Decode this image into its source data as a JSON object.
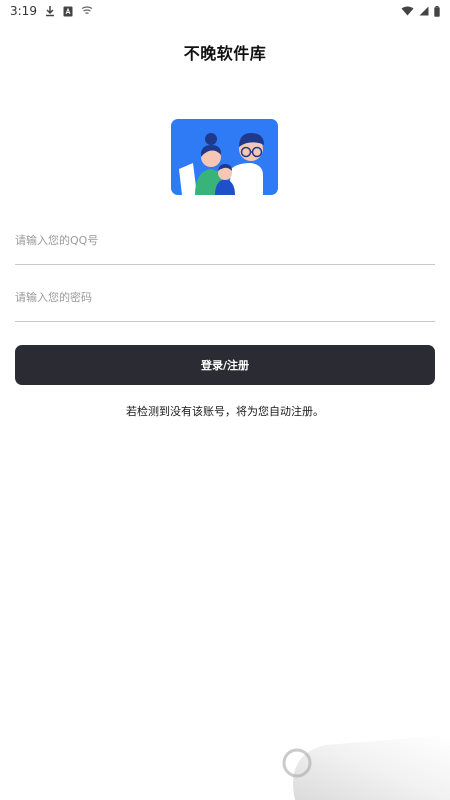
{
  "status_bar": {
    "time": "3:19",
    "icons_left": [
      "download-icon",
      "a-box-icon",
      "cast-icon"
    ],
    "icons_right": [
      "wifi-icon",
      "signal-icon",
      "battery-icon"
    ]
  },
  "app": {
    "title": "不晚软件库"
  },
  "illustration": {
    "icon": "family-illustration-icon",
    "bg_color": "#2f7bf5"
  },
  "form": {
    "qq_placeholder": "请输入您的QQ号",
    "qq_value": "",
    "password_placeholder": "请输入您的密码",
    "password_value": "",
    "submit_label": "登录/注册"
  },
  "hint_text": "若检测到没有该账号，将为您自动注册。",
  "colors": {
    "button_bg": "#2b2c33",
    "divider": "#c8c8c8",
    "accent_blue": "#2f7bf5"
  }
}
